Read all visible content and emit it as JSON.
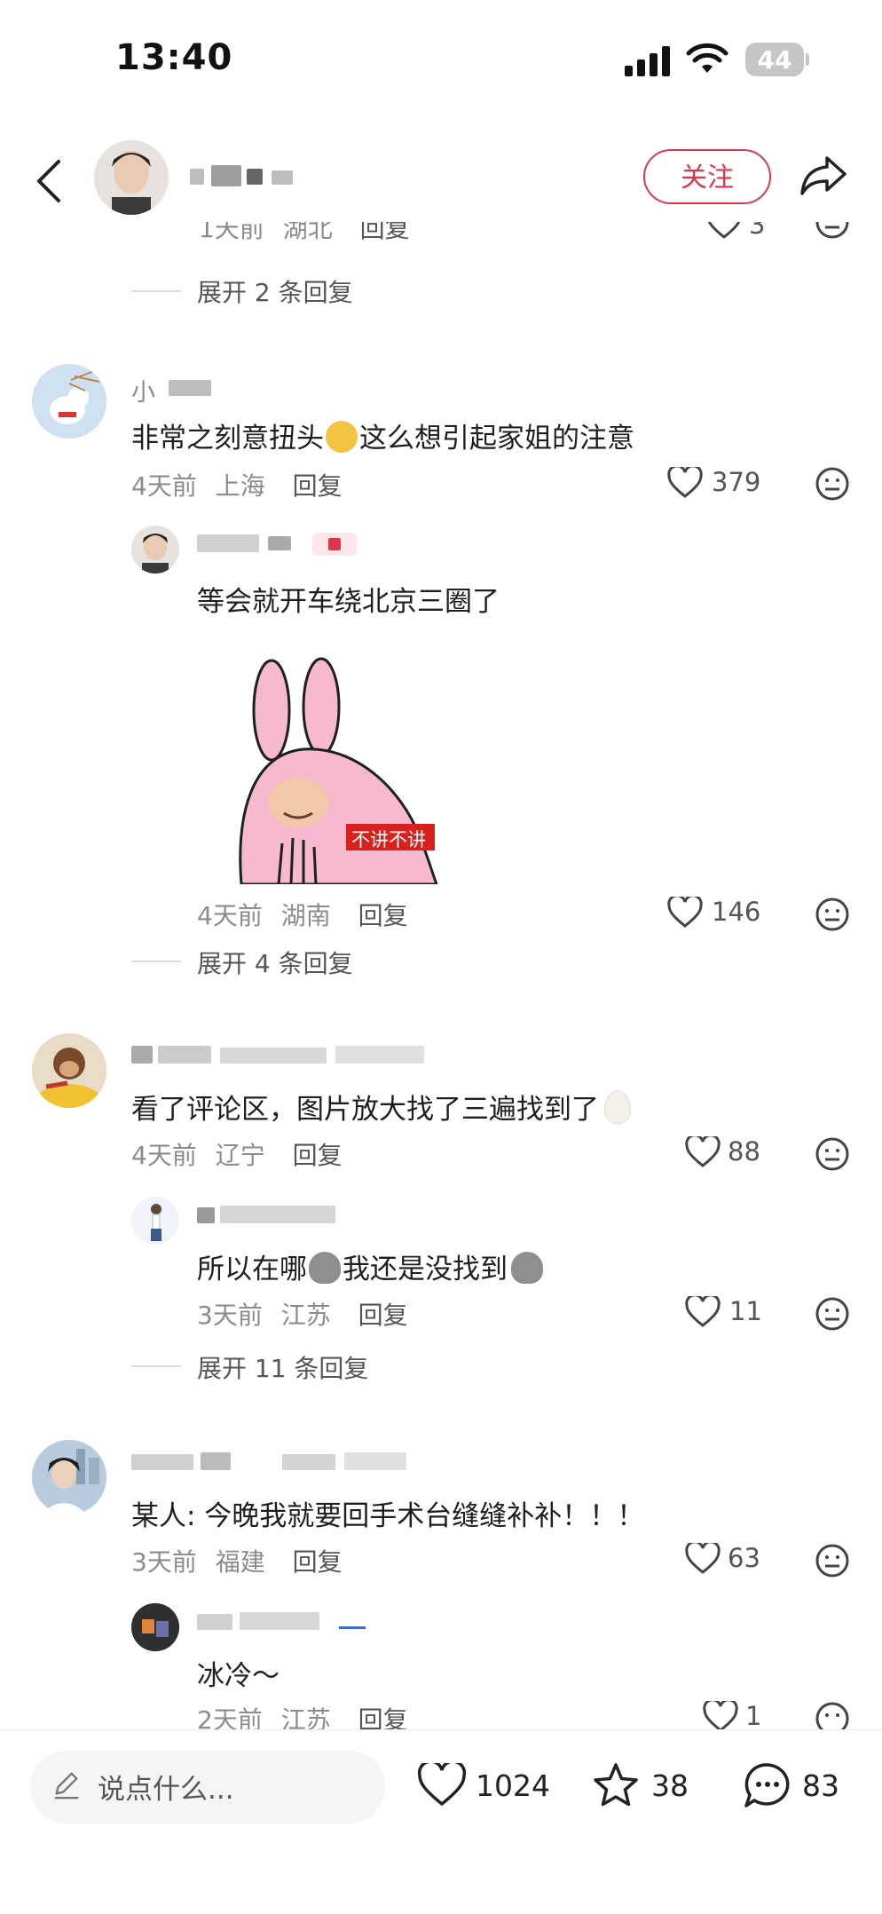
{
  "status_bar": {
    "time": "13:40",
    "battery": "44"
  },
  "header": {
    "follow_label": "关注"
  },
  "comments": [
    {
      "partial": true,
      "meta_time": "1天前",
      "meta_loc": "湖北",
      "reply_label": "回复",
      "likes": "3",
      "expand": "展开 2 条回复"
    },
    {
      "username": "小",
      "text": "非常之刻意扭头",
      "text_after": "这么想引起家姐的注意",
      "meta_time": "4天前",
      "meta_loc": "上海",
      "reply_label": "回复",
      "likes": "379",
      "reply": {
        "text": "等会就开车绕北京三圈了",
        "sticker_caption": "不讲不讲",
        "meta_time": "4天前",
        "meta_loc": "湖南",
        "reply_label": "回复",
        "likes": "146"
      },
      "expand": "展开 4 条回复"
    },
    {
      "text": "看了评论区，图片放大找了三遍找到了",
      "meta_time": "4天前",
      "meta_loc": "辽宁",
      "reply_label": "回复",
      "likes": "88",
      "reply": {
        "text_a": "所以在哪",
        "text_b": "我还是没找到",
        "meta_time": "3天前",
        "meta_loc": "江苏",
        "reply_label": "回复",
        "likes": "11"
      },
      "expand": "展开 11 条回复"
    },
    {
      "text": "某人: 今晚我就要回手术台缝缝补补！！！",
      "meta_time": "3天前",
      "meta_loc": "福建",
      "reply_label": "回复",
      "likes": "63",
      "reply": {
        "text": "冰冷～",
        "meta_time": "2天前",
        "meta_loc": "江苏",
        "reply_label": "回复",
        "likes": "1"
      }
    }
  ],
  "bottom_bar": {
    "input_placeholder": "说点什么...",
    "likes": "1024",
    "stars": "38",
    "comments": "83"
  },
  "colors": {
    "accent": "#e0364b",
    "meta": "#8c8c8c",
    "sticker_bg": "#f6b9cf"
  }
}
